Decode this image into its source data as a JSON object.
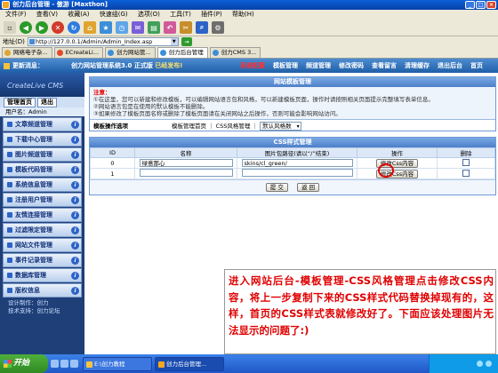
{
  "window": {
    "title": "创力后台管理 - 傲游 [Maxthon]"
  },
  "menu": [
    "文件(F)",
    "查看(V)",
    "收藏(A)",
    "快速组(G)",
    "选项(O)",
    "工具(T)",
    "插件(P)",
    "帮助(H)"
  ],
  "address": {
    "label": "地址(D)",
    "value": "http://127.0.0.1/Admin/Admin_Index.asp"
  },
  "tabs": [
    "网络电子杂...",
    "ECreateLi...",
    "创力网站管...",
    "创力后台管理",
    "创力CMS 3..."
  ],
  "adminbar": {
    "lead": "更新消息：",
    "version_prefix": "创力网站管理系统3.0 正式版",
    "version_highlight": "已经发布!",
    "nav": [
      "系统配置",
      "模板管理",
      "频道管理",
      "修改密码",
      "查看留言",
      "清理缓存",
      "退出后台",
      "首页"
    ]
  },
  "sidebar": {
    "brand": "CreateLive CMS",
    "tabs": [
      "管理首页",
      "退出"
    ],
    "user": "用户名：Admin",
    "items": [
      "文章频道管理",
      "下载中心管理",
      "图片频道管理",
      "模板代码管理",
      "系统信息管理",
      "注册用户管理",
      "友情连接管理",
      "过滤限定管理",
      "网站文件管理",
      "事件记录管理",
      "数据库管理",
      "版权信息"
    ],
    "footer": [
      "设计制作：创力",
      "技术支持：创力论坛"
    ]
  },
  "template_panel": {
    "title": "网站模板管理",
    "notice_title": "注意：",
    "notice_lines": [
      "①在这里，您可以新建和修改模板，可以编辑网站语言包和风格，可以新建模板页面，操作时请按照相关页面提示完整填写表单信息。",
      "②网站语言包是在使用的默认模板不能删除。",
      "③如果修改了模板页面名称或删除了模板页面请在关闭网站之后操作，否则可能会影响网站访问。"
    ],
    "row_label": "模板操作选项",
    "row_links": "模板管理首页 ｜ CSS风格管理 ｜",
    "select_value": "默认风格数"
  },
  "css_panel": {
    "title": "CSS样式管理",
    "headers": [
      "ID",
      "名称",
      "图片包路径(请以“/”结束)",
      "操作",
      "删除"
    ],
    "rows": [
      {
        "id": "0",
        "name": "绿意那心",
        "path": "skins/cl_green/",
        "op": "修改Css内容"
      },
      {
        "id": "1",
        "name": "",
        "path": "",
        "op": "修改Css内容"
      }
    ],
    "submit": "提 交",
    "reset": "返 回"
  },
  "caption": "进入网站后台-模板管理-CSS风格管理点击修改CSS内容，将上一步复制下来的CSS样式代码替换掉现有的，这样，首页的CSS样式表就修改好了。下面应该处理图片无法显示的问题了:)",
  "taskbar": {
    "start": "开始",
    "tasks": [
      "E:\\创力教程",
      "创力后台管理..."
    ],
    "clock": ""
  }
}
